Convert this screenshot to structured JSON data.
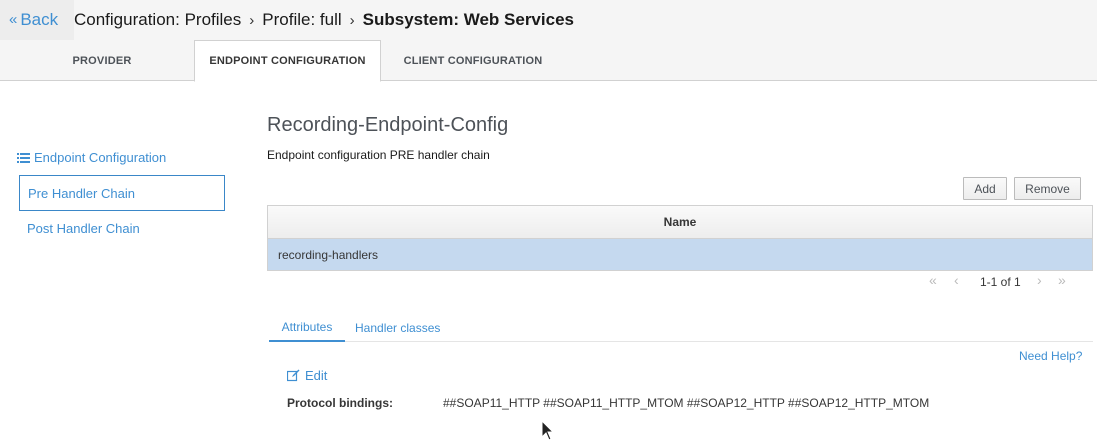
{
  "header": {
    "back_label": "Back",
    "breadcrumb": [
      "Configuration: Profiles",
      "Profile: full"
    ],
    "current": "Subsystem: Web Services"
  },
  "tabs": [
    {
      "label": "PROVIDER",
      "active": false
    },
    {
      "label": "ENDPOINT CONFIGURATION",
      "active": true
    },
    {
      "label": "CLIENT CONFIGURATION",
      "active": false
    }
  ],
  "nav": {
    "heading": "Endpoint Configuration",
    "heading_icon": "list-icon",
    "items": [
      {
        "label": "Pre Handler Chain",
        "active": true
      },
      {
        "label": "Post Handler Chain",
        "active": false
      }
    ]
  },
  "main": {
    "title": "Recording-Endpoint-Config",
    "description": "Endpoint configuration PRE handler chain",
    "add_label": "Add",
    "remove_label": "Remove",
    "table": {
      "columns": [
        "Name"
      ],
      "rows": [
        {
          "name": "recording-handlers",
          "selected": true
        }
      ]
    },
    "pager": {
      "text": "1-1 of 1"
    },
    "subtabs": [
      {
        "label": "Attributes",
        "active": true
      },
      {
        "label": "Handler classes",
        "active": false
      }
    ],
    "help_label": "Need Help?",
    "edit_label": "Edit",
    "attributes": [
      {
        "label": "Protocol bindings:",
        "value": "##SOAP11_HTTP ##SOAP11_HTTP_MTOM ##SOAP12_HTTP ##SOAP12_HTTP_MTOM"
      }
    ]
  },
  "colors": {
    "link": "#3f8fd2",
    "selected_row": "#c5d9ef",
    "active_border": "#3a87c8"
  }
}
